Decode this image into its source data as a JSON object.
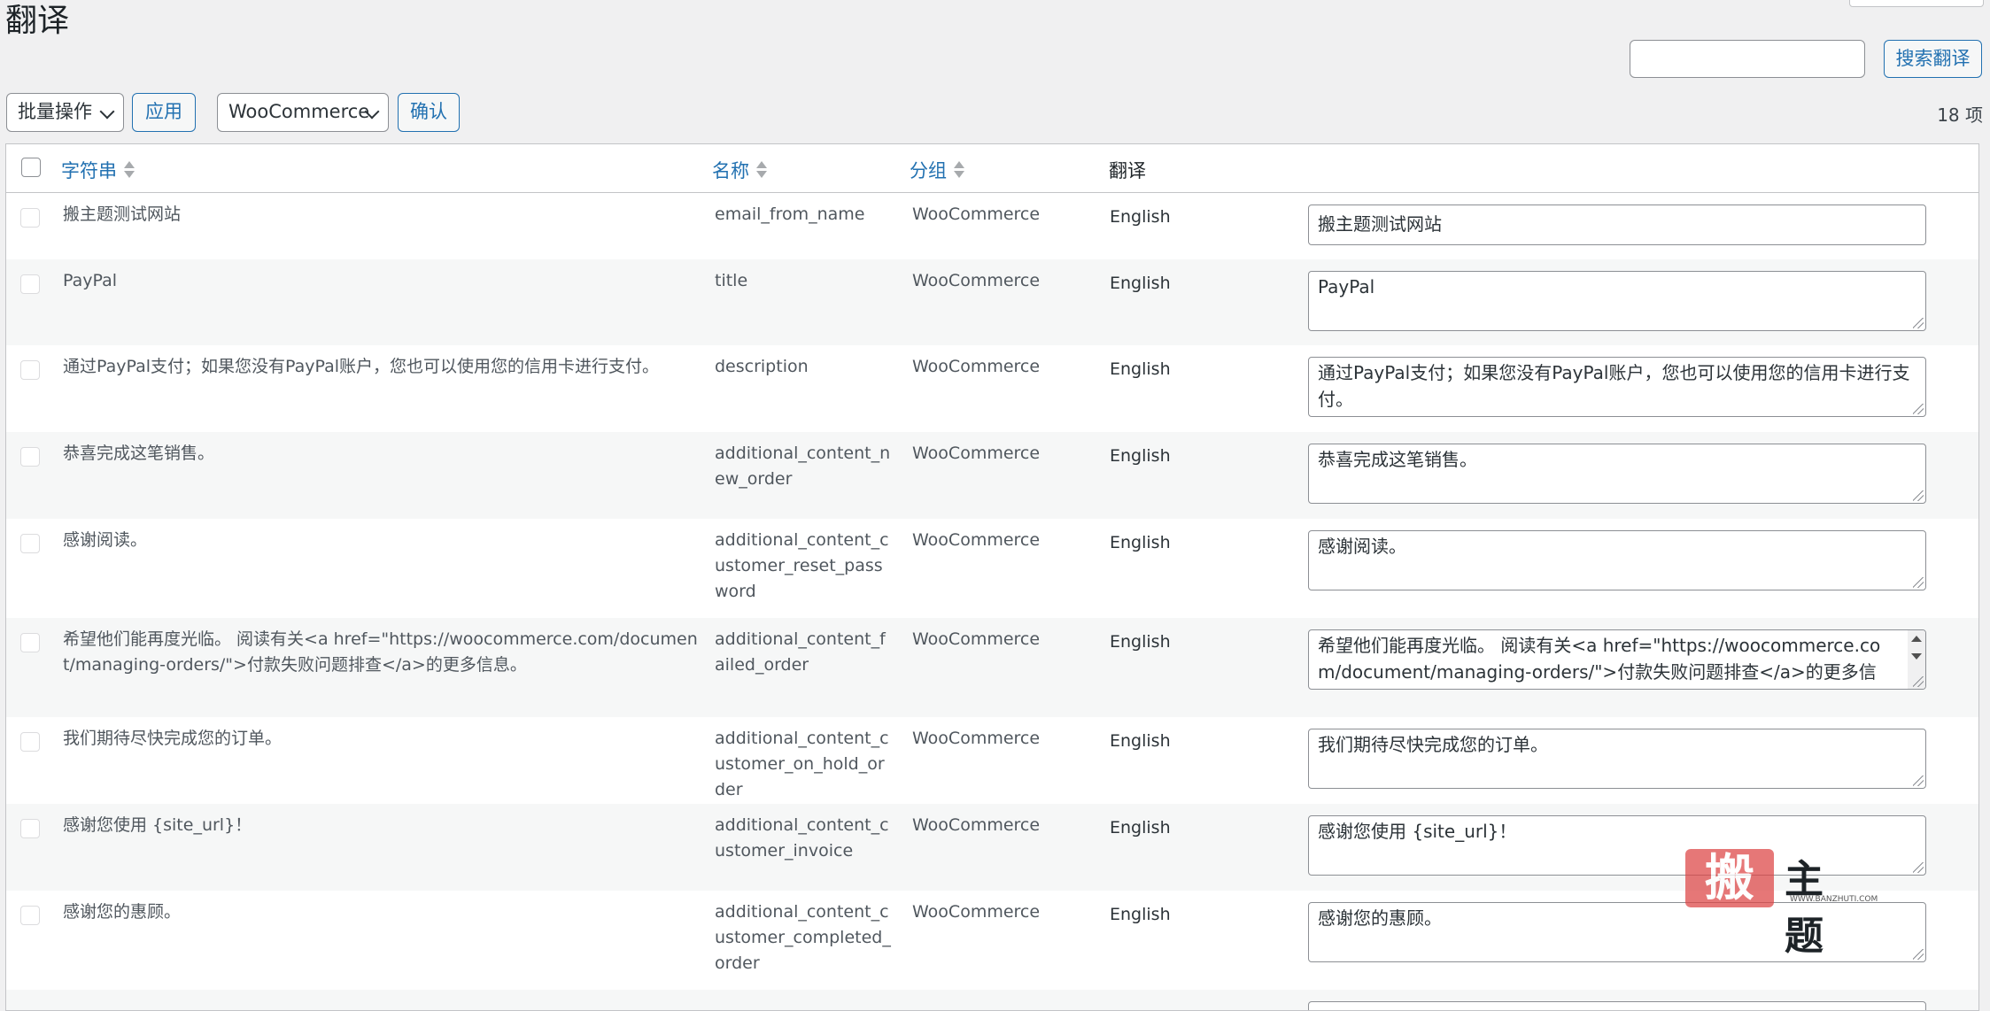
{
  "page": {
    "title": "翻译"
  },
  "search": {
    "placeholder": "",
    "button_label": "搜索翻译"
  },
  "toolbar": {
    "bulk_action_label": "批量操作",
    "apply_label": "应用",
    "group_filter_label": "WooCommerce",
    "confirm_label": "确认",
    "item_count": "18 项"
  },
  "table": {
    "headers": {
      "string": "字符串",
      "name": "名称",
      "group": "分组",
      "translation": "翻译"
    },
    "rows": [
      {
        "string": "搬主题测试网站",
        "name": "email_from_name",
        "group": "WooCommerce",
        "language": "English",
        "translation": "搬主题测试网站"
      },
      {
        "string": "PayPal",
        "name": "title",
        "group": "WooCommerce",
        "language": "English",
        "translation": "PayPal"
      },
      {
        "string": "通过PayPal支付；如果您没有PayPal账户，您也可以使用您的信用卡进行支付。",
        "name": "description",
        "group": "WooCommerce",
        "language": "English",
        "translation": "通过PayPal支付；如果您没有PayPal账户，您也可以使用您的信用卡进行支付。"
      },
      {
        "string": "恭喜完成这笔销售。",
        "name": "additional_content_new_order",
        "group": "WooCommerce",
        "language": "English",
        "translation": "恭喜完成这笔销售。"
      },
      {
        "string": "感谢阅读。",
        "name": "additional_content_customer_reset_password",
        "group": "WooCommerce",
        "language": "English",
        "translation": "感谢阅读。"
      },
      {
        "string": "希望他们能再度光临。 阅读有关<a href=\"https://woocommerce.com/document/managing-orders/\">付款失败问题排查</a>的更多信息。",
        "name": "additional_content_failed_order",
        "group": "WooCommerce",
        "language": "English",
        "translation": "希望他们能再度光临。 阅读有关<a href=\"https://woocommerce.com/document/managing-orders/\">付款失败问题排查</a>的更多信息。"
      },
      {
        "string": "我们期待尽快完成您的订单。",
        "name": "additional_content_customer_on_hold_order",
        "group": "WooCommerce",
        "language": "English",
        "translation": "我们期待尽快完成您的订单。"
      },
      {
        "string": "感谢您使用 {site_url}！",
        "name": "additional_content_customer_invoice",
        "group": "WooCommerce",
        "language": "English",
        "translation": "感谢您使用 {site_url}！"
      },
      {
        "string": "感谢您的惠顾。",
        "name": "additional_content_customer_completed_order",
        "group": "WooCommerce",
        "language": "English",
        "translation": "感谢您的惠顾。"
      }
    ]
  },
  "watermark": {
    "seal": "搬",
    "text": "主题",
    "url": "WWW.BANZHUTI.COM"
  }
}
